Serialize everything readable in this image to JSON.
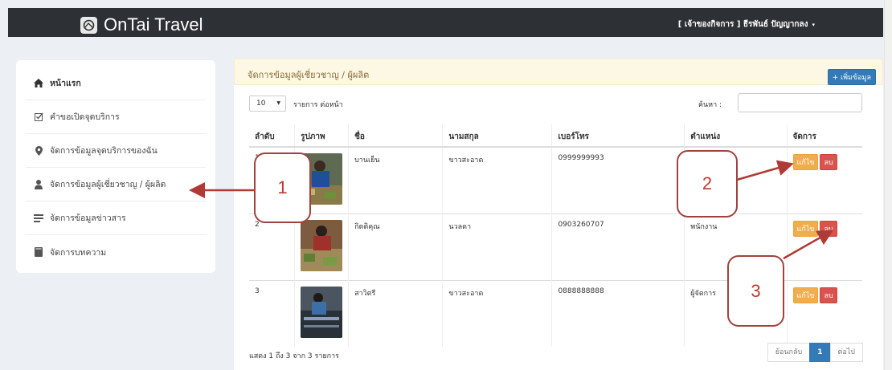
{
  "navbar": {
    "brand": "OnTai Travel",
    "user": "[ เจ้าของกิจการ ] ธีรพันธ์ ปัญญากลง",
    "caret": "▾"
  },
  "sidebar": {
    "items": [
      {
        "label": "หน้าแรก",
        "icon": "home-icon"
      },
      {
        "label": "คำขอเปิดจุดบริการ",
        "icon": "check-square-icon"
      },
      {
        "label": "จัดการข้อมูลจุดบริการของฉัน",
        "icon": "map-marker-icon"
      },
      {
        "label": "จัดการข้อมูลผู้เชี่ยวชาญ / ผู้ผลิต",
        "icon": "user-icon"
      },
      {
        "label": "จัดการข้อมูลข่าวสาร",
        "icon": "news-icon"
      },
      {
        "label": "จัดการบทความ",
        "icon": "book-icon"
      }
    ]
  },
  "panel": {
    "title": "จัดการข้อมูลผู้เชี่ยวชาญ / ผู้ผลิต",
    "add_button": "+ เพิ่มข้อมูล"
  },
  "controls": {
    "page_length": "10",
    "length_label": "รายการ ต่อหน้า",
    "search_label": "ค้นหา :",
    "search_value": ""
  },
  "table": {
    "headers": [
      "ลำดับ",
      "รูปภาพ",
      "ชื่อ",
      "นามสกุล",
      "เบอร์โทร",
      "ตำแหน่ง",
      "จัดการ"
    ],
    "rows": [
      {
        "no": "1",
        "first": "บานเย็น",
        "last": "ขาวสะอาด",
        "phone": "0999999993",
        "position": ""
      },
      {
        "no": "2",
        "first": "กิตติคุณ",
        "last": "นวลดา",
        "phone": "0903260707",
        "position": "พนักงาน"
      },
      {
        "no": "3",
        "first": "สาวิตรี",
        "last": "ขาวสะอาด",
        "phone": "0888888888",
        "position": "ผู้จัดการ"
      }
    ],
    "edit_label": "แก้ไข",
    "delete_label": "ลบ"
  },
  "footer": {
    "info": "แสดง 1 ถึง 3 จาก 3 รายการ",
    "prev": "ย้อนกลับ",
    "page": "1",
    "next": "ต่อไป"
  },
  "annotations": [
    "1",
    "2",
    "3"
  ],
  "colors": {
    "navbar": "#2d3035",
    "panel_header": "#fcf8e3",
    "primary": "#337ab7",
    "warning": "#f0ad4e",
    "danger": "#d9534f",
    "annotation": "#b03a35"
  }
}
